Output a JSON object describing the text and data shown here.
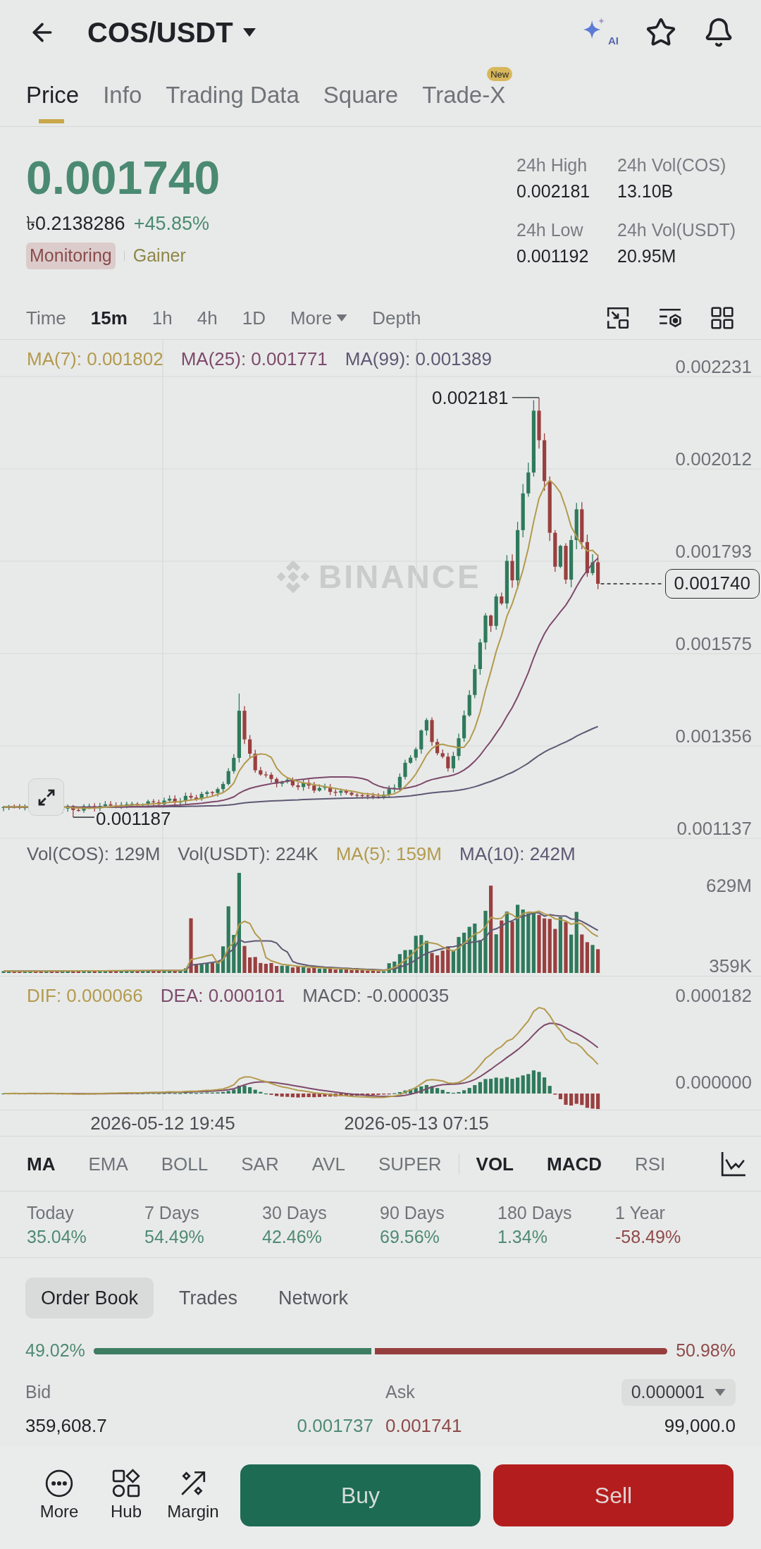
{
  "header": {
    "title": "COS/USDT",
    "ai_label": "AI"
  },
  "tabs": [
    {
      "label": "Price",
      "selected": true
    },
    {
      "label": "Info",
      "selected": false
    },
    {
      "label": "Trading Data",
      "selected": false
    },
    {
      "label": "Square",
      "selected": false
    },
    {
      "label": "Trade-X",
      "selected": false,
      "badge": "New"
    }
  ],
  "ticker": {
    "price": "0.001740",
    "fiat_price": "৳0.2138286",
    "change": "+45.85%",
    "tags": [
      {
        "label": "Monitoring",
        "kind": "warning"
      },
      {
        "label": "Gainer",
        "kind": "gainer"
      }
    ],
    "stats": [
      {
        "label": "24h High",
        "value": "0.002181"
      },
      {
        "label": "24h Vol(COS)",
        "value": "13.10B"
      },
      {
        "label": "24h Low",
        "value": "0.001192"
      },
      {
        "label": "24h Vol(USDT)",
        "value": "20.95M"
      }
    ]
  },
  "intervals": [
    {
      "label": "Time",
      "selected": false,
      "kind": "option"
    },
    {
      "label": "15m",
      "selected": true,
      "kind": "option"
    },
    {
      "label": "1h",
      "selected": false,
      "kind": "option"
    },
    {
      "label": "4h",
      "selected": false,
      "kind": "option"
    },
    {
      "label": "1D",
      "selected": false,
      "kind": "option"
    },
    {
      "label": "More",
      "selected": false,
      "kind": "menu"
    },
    {
      "label": "Depth",
      "selected": false,
      "kind": "option"
    }
  ],
  "price_chart": {
    "legend": [
      {
        "label": "MA(7): 0.001802",
        "color": "#b39a4d"
      },
      {
        "label": "MA(25): 0.001771",
        "color": "#7e4a6c"
      },
      {
        "label": "MA(99): 0.001389",
        "color": "#5f5874"
      }
    ],
    "y_labels": [
      "0.002231",
      "0.002012",
      "0.001793",
      "0.001575",
      "0.001356",
      "0.001137"
    ],
    "high_label": "0.002181",
    "low_label": "0.001187",
    "last_price": "0.001740",
    "watermark": "BINANCE"
  },
  "volume_chart": {
    "legend": [
      {
        "label": "Vol(COS): 129M",
        "color": "#5c6066"
      },
      {
        "label": "Vol(USDT): 224K",
        "color": "#5c6066"
      },
      {
        "label": "MA(5): 159M",
        "color": "#b39a4d"
      },
      {
        "label": "MA(10): 242M",
        "color": "#5f5874"
      }
    ],
    "y_labels": [
      "629M",
      "359K"
    ]
  },
  "macd_chart": {
    "legend": [
      {
        "label": "DIF: 0.000066",
        "color": "#b39a4d"
      },
      {
        "label": "DEA: 0.000101",
        "color": "#7e4a6c"
      },
      {
        "label": "MACD: -0.000035",
        "color": "#5c6066"
      }
    ],
    "y_labels": [
      "0.000182",
      "0.000000"
    ]
  },
  "time_axis": [
    "2026-05-12 19:45",
    "2026-05-13 07:15"
  ],
  "indicators": {
    "main": [
      {
        "label": "MA",
        "selected": true
      },
      {
        "label": "EMA",
        "selected": false
      },
      {
        "label": "BOLL",
        "selected": false
      },
      {
        "label": "SAR",
        "selected": false
      },
      {
        "label": "AVL",
        "selected": false
      },
      {
        "label": "SUPER",
        "selected": false
      }
    ],
    "sub": [
      {
        "label": "VOL",
        "selected": true
      },
      {
        "label": "MACD",
        "selected": true
      },
      {
        "label": "RSI",
        "selected": false
      }
    ]
  },
  "performance": [
    {
      "label": "Today",
      "value": "35.04%",
      "color": "#4f8a74"
    },
    {
      "label": "7 Days",
      "value": "54.49%",
      "color": "#4f8a74"
    },
    {
      "label": "30 Days",
      "value": "42.46%",
      "color": "#4f8a74"
    },
    {
      "label": "90 Days",
      "value": "69.56%",
      "color": "#4f8a74"
    },
    {
      "label": "180 Days",
      "value": "1.34%",
      "color": "#4f8a74"
    },
    {
      "label": "1 Year",
      "value": "-58.49%",
      "color": "#8f4a4a"
    }
  ],
  "order_tabs": [
    {
      "label": "Order Book",
      "selected": true
    },
    {
      "label": "Trades",
      "selected": false
    },
    {
      "label": "Network",
      "selected": false
    }
  ],
  "depth_ratio": {
    "bid": "49.02%",
    "ask": "50.98%",
    "level": 0.4902
  },
  "order_book": {
    "bid_header": "Bid",
    "ask_header": "Ask",
    "precision": "0.000001",
    "rows": [
      {
        "bid_amount": "359,608.7",
        "bid_price": "0.001737",
        "ask_price": "0.001741",
        "ask_amount": "99,000.0"
      }
    ]
  },
  "bottom_bar": {
    "actions": [
      {
        "label": "More",
        "kind": "more"
      },
      {
        "label": "Hub",
        "kind": "hub"
      },
      {
        "label": "Margin",
        "kind": "margin"
      }
    ],
    "buy": "Buy",
    "sell": "Sell"
  }
}
